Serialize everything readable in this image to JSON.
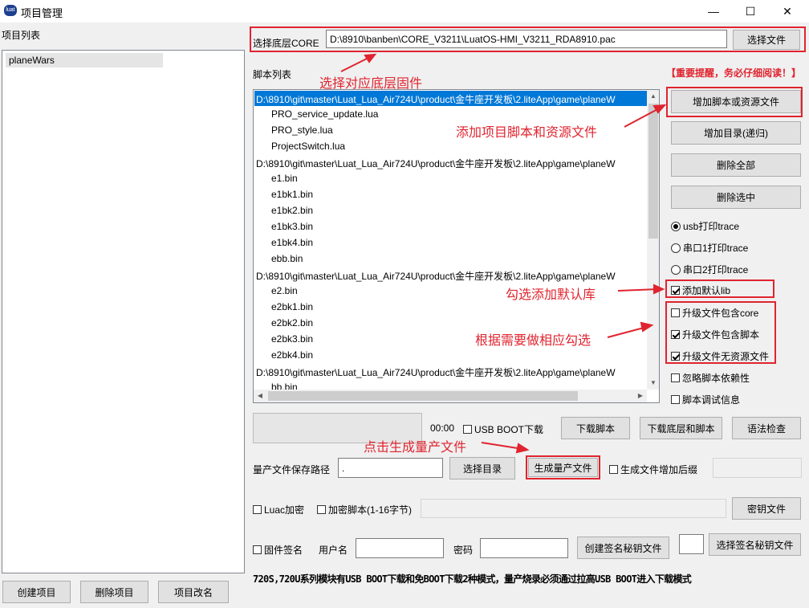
{
  "window": {
    "title": "项目管理",
    "icon": "app-icon"
  },
  "controls": {
    "minimize": "—",
    "maximize": "☐",
    "close": "✕"
  },
  "left": {
    "list_label": "项目列表",
    "projects": [
      "planeWars"
    ],
    "buttons": {
      "create": "创建项目",
      "delete": "删除项目",
      "rename": "项目改名"
    }
  },
  "core": {
    "label": "选择底层CORE",
    "path": "D:\\8910\\banben\\CORE_V3211\\LuatOS-HMI_V3211_RDA8910.pac",
    "button": "选择文件"
  },
  "script": {
    "label": "脚本列表",
    "warning": "【重要提醒，务必仔细阅读！】",
    "items": [
      "D:\\8910\\git\\master\\Luat_Lua_Air724U\\product\\金牛座开发板\\2.liteApp\\game\\planeW",
      "PRO_service_update.lua",
      "PRO_style.lua",
      "ProjectSwitch.lua",
      "D:\\8910\\git\\master\\Luat_Lua_Air724U\\product\\金牛座开发板\\2.liteApp\\game\\planeW",
      "e1.bin",
      "e1bk1.bin",
      "e1bk2.bin",
      "e1bk3.bin",
      "e1bk4.bin",
      "ebb.bin",
      "D:\\8910\\git\\master\\Luat_Lua_Air724U\\product\\金牛座开发板\\2.liteApp\\game\\planeW",
      "e2.bin",
      "e2bk1.bin",
      "e2bk2.bin",
      "e2bk3.bin",
      "e2bk4.bin",
      "D:\\8910\\git\\master\\Luat_Lua_Air724U\\product\\金牛座开发板\\2.liteApp\\game\\planeW",
      "bb.bin"
    ]
  },
  "right": {
    "add_file": "增加脚本或资源文件",
    "add_dir": "增加目录(递归)",
    "delete_all": "删除全部",
    "delete_selected": "删除选中",
    "radios": [
      "usb打印trace",
      "串口1打印trace",
      "串口2打印trace"
    ],
    "checks": [
      "添加默认lib",
      "升级文件包含core",
      "升级文件包含脚本",
      "升级文件无资源文件",
      "忽略脚本依赖性",
      "脚本调试信息"
    ]
  },
  "download": {
    "time": "00:00",
    "usb_boot": "USB BOOT下载",
    "dl_script": "下载脚本",
    "dl_core_script": "下载底层和脚本",
    "syntax": "语法检查"
  },
  "mass": {
    "label": "量产文件保存路径",
    "path": ".",
    "choose_dir": "选择目录",
    "generate": "生成量产文件",
    "suffix": "生成文件增加后缀"
  },
  "encrypt": {
    "luac": "Luac加密",
    "encrypt_script": "加密脚本(1-16字节)",
    "key_file": "密钥文件"
  },
  "sign": {
    "firmware_sign": "固件签名",
    "user_label": "用户名",
    "pwd_label": "密码",
    "create_key": "创建签名秘钥文件",
    "choose_key": "选择签名秘钥文件"
  },
  "footer_note": "720S,720U系列模块有USB BOOT下载和免BOOT下载2种模式，量产烧录必须通过拉高USB BOOT进入下载模式",
  "annotations": {
    "core": "选择对应底层固件",
    "add": "添加项目脚本和资源文件",
    "lib": "勾选添加默认库",
    "need": "根据需要做相应勾选",
    "generate": "点击生成量产文件"
  }
}
